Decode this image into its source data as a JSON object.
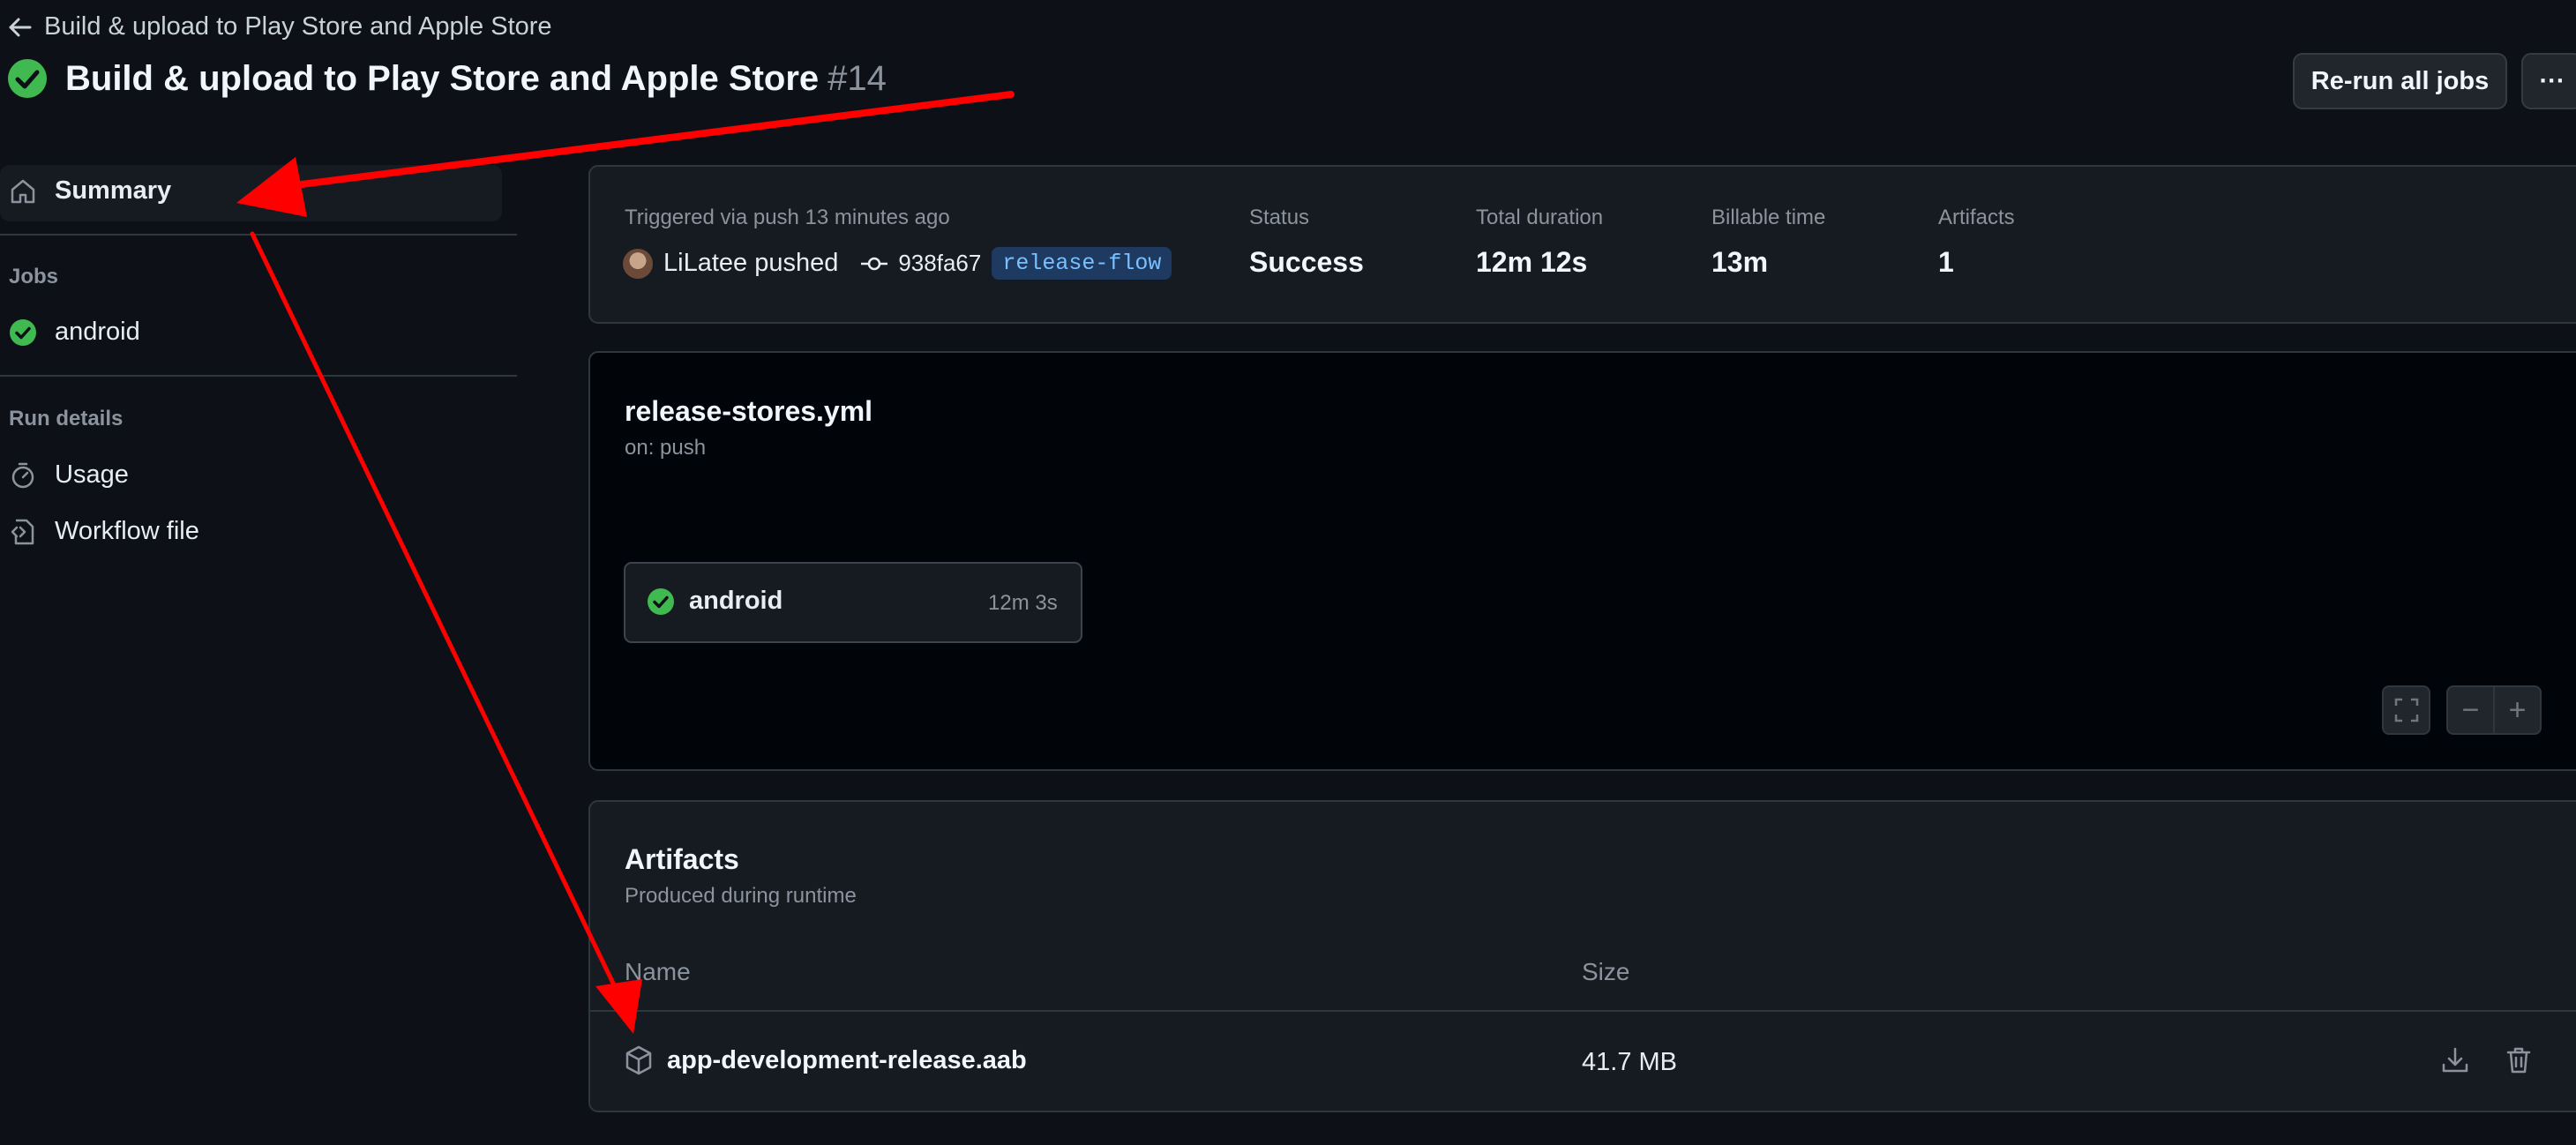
{
  "header": {
    "back_label": "Build & upload to Play Store and Apple Store",
    "title": "Build & upload to Play Store and Apple Store",
    "run_number": "#14",
    "rerun_label": "Re-run all jobs",
    "more_label": "···"
  },
  "sidebar": {
    "summary_label": "Summary",
    "jobs_heading": "Jobs",
    "job_label": "android",
    "run_details_heading": "Run details",
    "usage_label": "Usage",
    "workflow_label": "Workflow file"
  },
  "summary": {
    "trigger_text": "Triggered via push 13 minutes ago",
    "actor": "LiLatee pushed",
    "commit": "938fa67",
    "branch": "release-flow",
    "status_label": "Status",
    "status_value": "Success",
    "duration_label": "Total duration",
    "duration_value": "12m 12s",
    "billable_label": "Billable time",
    "billable_value": "13m",
    "artifacts_label": "Artifacts",
    "artifacts_value": "1"
  },
  "workflow": {
    "file": "release-stores.yml",
    "trigger": "on: push",
    "job_name": "android",
    "job_time": "12m 3s",
    "zoom_out": "−",
    "zoom_in": "+"
  },
  "artifacts": {
    "title": "Artifacts",
    "subtitle": "Produced during runtime",
    "col_name": "Name",
    "col_size": "Size",
    "rows": [
      {
        "name": "app-development-release.aab",
        "size": "41.7 MB"
      }
    ]
  },
  "colors": {
    "success": "#3fb950",
    "annotation_arrow": "#ff0000",
    "background": "#0d1117"
  }
}
